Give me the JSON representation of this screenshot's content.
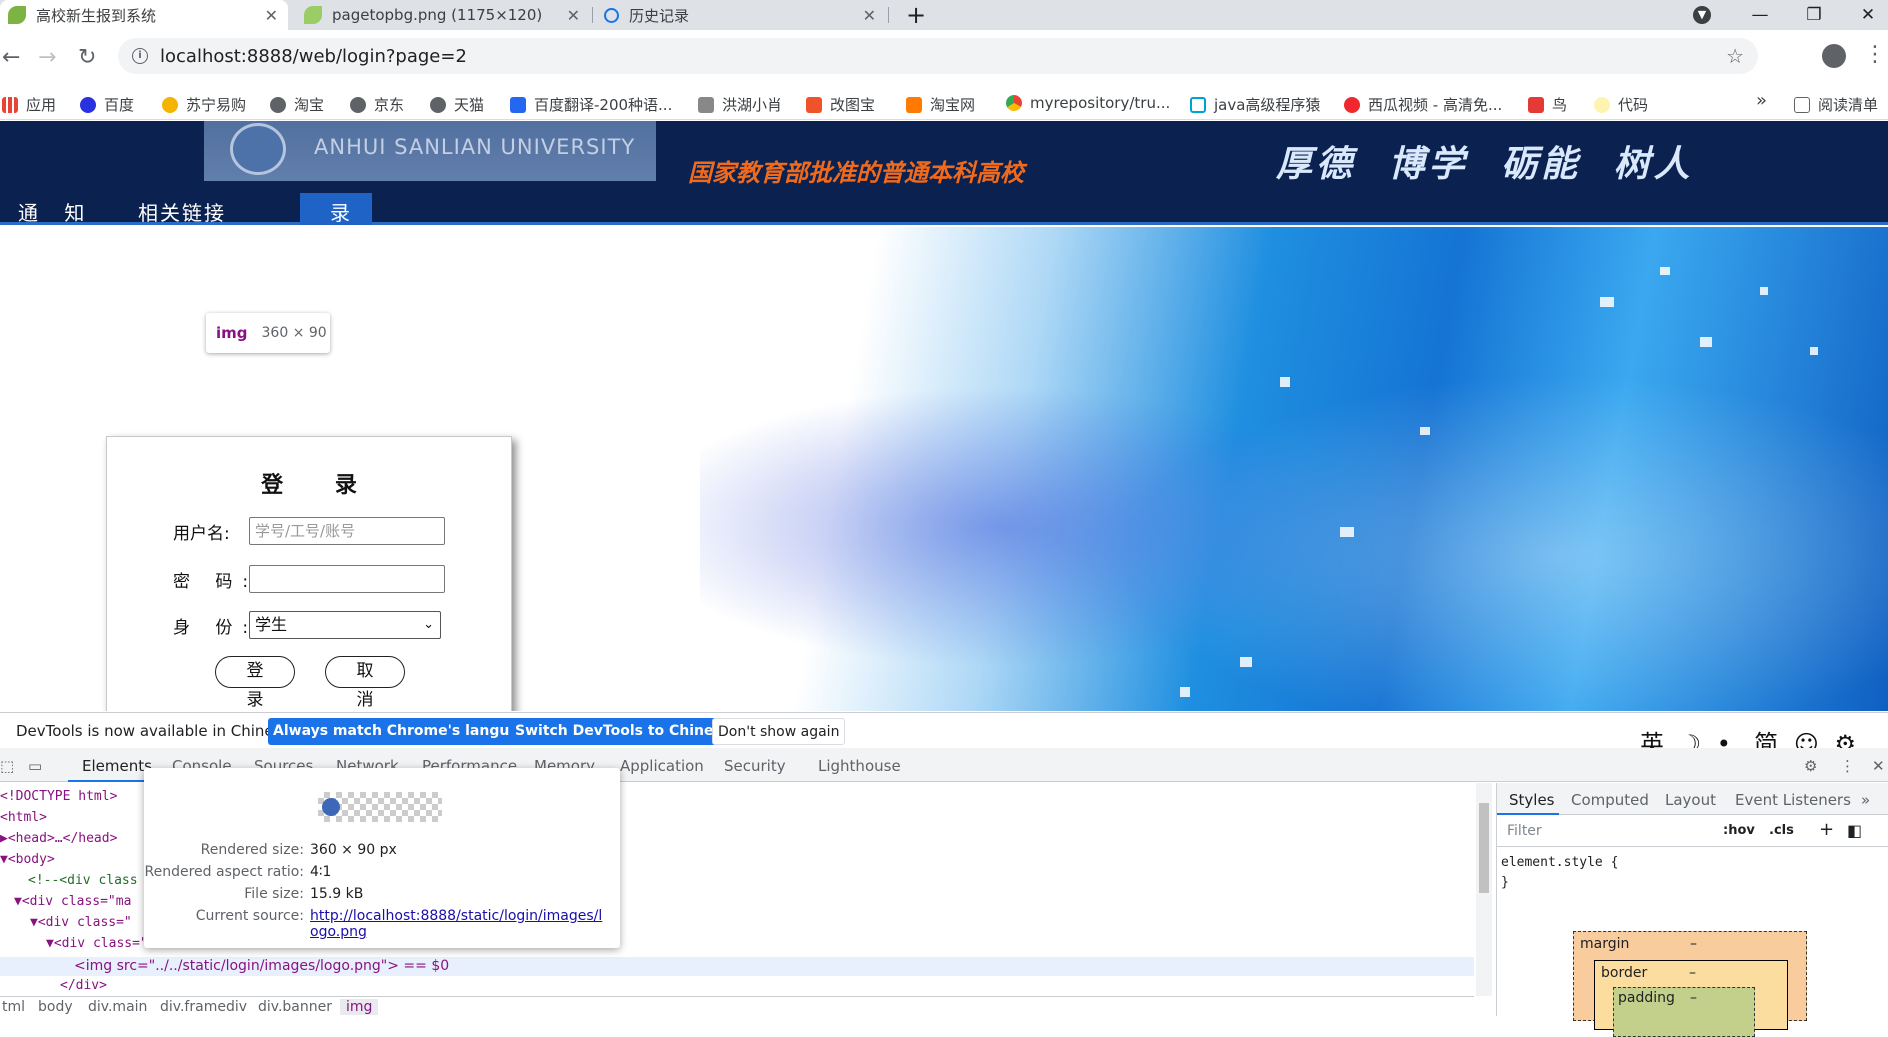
{
  "browser": {
    "tabs": [
      {
        "title": "高校新生报到系统",
        "active": true
      },
      {
        "title": "pagetopbg.png (1175×120)",
        "active": false
      },
      {
        "title": "历史记录",
        "active": false
      }
    ],
    "url": "localhost:8888/web/login?page=2",
    "new_tab_symbol": "+",
    "window_controls": {
      "minimize": "—",
      "maximize": "❐",
      "close": "✕"
    }
  },
  "bookmarks": {
    "items": [
      "应用",
      "百度",
      "苏宁易购",
      "淘宝",
      "京东",
      "天猫",
      "百度翻译-200种语...",
      "洪湖小肖",
      "改图宝",
      "淘宝网",
      "myrepository/tru...",
      "java高级程序猿",
      "西瓜视频 - 高清免...",
      "鸟",
      "代码"
    ],
    "overflow": "»",
    "reading_list": "阅读清单"
  },
  "site": {
    "logo_en": "ANHUI SANLIAN UNIVERSITY",
    "slogan_left": "国家教育部批准的普通本科高校",
    "slogan_right": "厚德 博学 砺能 树人",
    "nav": [
      "通 知",
      "相关链接",
      "录"
    ],
    "tooltip": {
      "tag": "img",
      "size": "360 × 90"
    }
  },
  "login": {
    "title": "登 录",
    "username_label": "用户名:",
    "username_placeholder": "学号/工号/账号",
    "password_label": "密 码:",
    "role_label": "身 份:",
    "role_value": "学生",
    "login_button": "登 录",
    "cancel_button": "取 消"
  },
  "devtools": {
    "infobar_text": "DevTools is now available in Chinese!",
    "infobar_buttons": [
      "Always match Chrome's language",
      "Switch DevTools to Chinese",
      "Don't show again"
    ],
    "ime": "英 ☽ •, 简 ☺ ⚙",
    "tabs": [
      "Elements",
      "Console",
      "Sources",
      "Network",
      "Performance",
      "Memory",
      "Application",
      "Security",
      "Lighthouse"
    ],
    "code_lines": [
      "<!DOCTYPE html>",
      "<html>",
      "▶<head>…</head>",
      "▼<body>",
      "<!--<div class",
      "▼<div class=\"ma",
      "▼<div class=\"",
      "▼<div class=\"banner\">",
      "<img src=\"../../static/login/images/logo.png\"> == $0",
      "</div>"
    ],
    "breadcrumbs": [
      "tml",
      "body",
      "div.main",
      "div.framediv",
      "div.banner",
      "img"
    ],
    "popup": {
      "rendered_size_key": "Rendered size:",
      "rendered_size": "360 × 90 px",
      "aspect_key": "Rendered aspect ratio:",
      "aspect": "4∶1",
      "filesize_key": "File size:",
      "filesize": "15.9 kB",
      "source_key": "Current source:",
      "source": "http://localhost:8888/static/login/images/logo.png"
    },
    "styles": {
      "tabs": [
        "Styles",
        "Computed",
        "Layout",
        "Event Listeners",
        "»"
      ],
      "filter_placeholder": "Filter",
      "hov": ":hov",
      "cls": ".cls",
      "element_style": "element.style {",
      "close_brace": "}",
      "box_margin": "margin",
      "box_border": "border",
      "box_padding": "padding",
      "dash": "–"
    }
  }
}
